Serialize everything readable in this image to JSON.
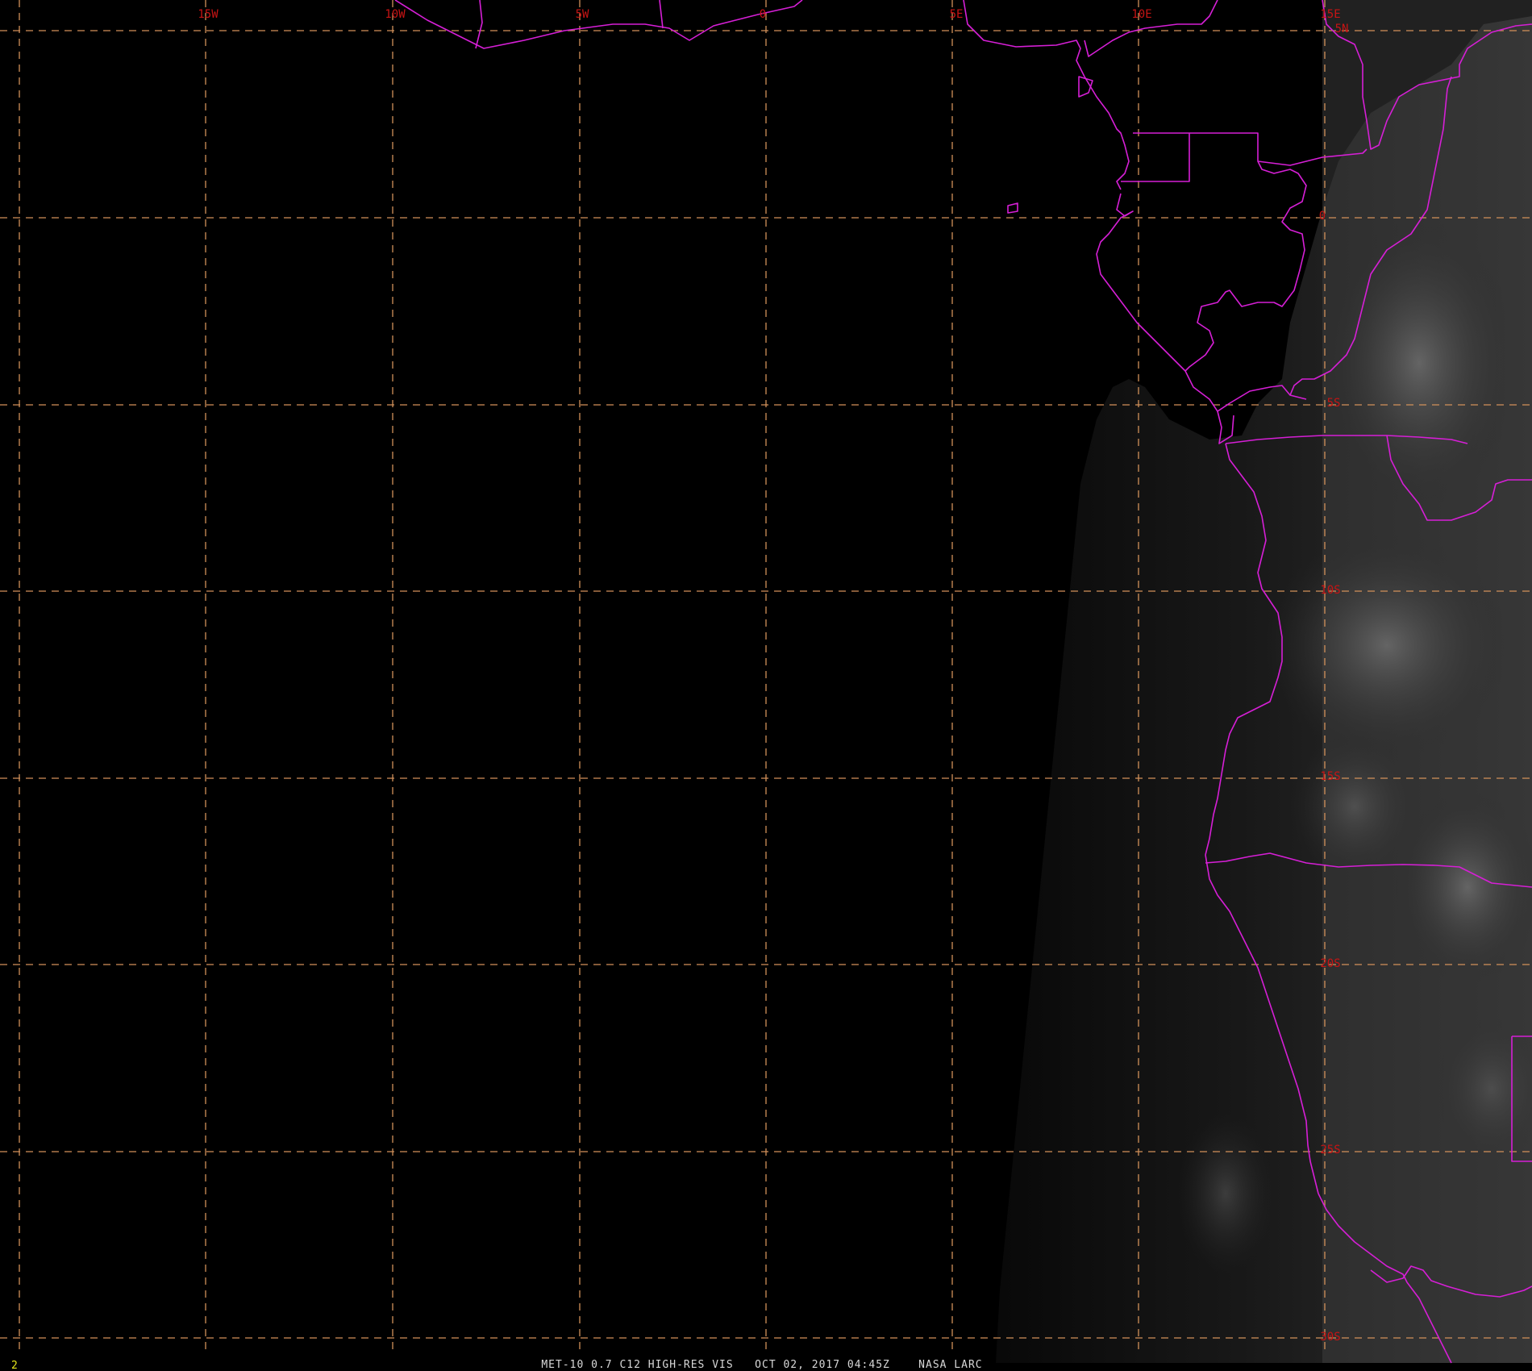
{
  "map": {
    "longitude_labels": [
      "15W",
      "10W",
      "5W",
      "0",
      "5E",
      "10E",
      "15E"
    ],
    "latitude_labels": [
      "5N",
      "0",
      "5S",
      "10S",
      "15S",
      "20S",
      "25S",
      "30S"
    ],
    "caption": "MET-10 0.7 C12 HIGH-RES VIS   OCT 02, 2017 04:45Z    NASA LARC",
    "frame_number": "2",
    "colors": {
      "background": "#000000",
      "grid": "#d2915a",
      "grid_label": "#c81414",
      "borders": "#d61fd6",
      "caption": "#d8d8d8",
      "frame_number": "#e6e619"
    }
  }
}
